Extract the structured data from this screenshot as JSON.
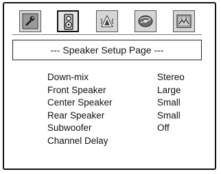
{
  "toolbar": {
    "tabs": [
      {
        "icon": "wrench-icon",
        "selected": false
      },
      {
        "icon": "speaker-icon",
        "selected": true
      },
      {
        "icon": "audio-icon",
        "selected": false
      },
      {
        "icon": "disc-icon",
        "selected": false
      },
      {
        "icon": "picture-icon",
        "selected": false
      }
    ]
  },
  "page": {
    "title": "--- Speaker Setup Page ---"
  },
  "menu": {
    "items": [
      {
        "label": "Down-mix",
        "value": "Stereo"
      },
      {
        "label": "Front Speaker",
        "value": "Large"
      },
      {
        "label": "Center Speaker",
        "value": "Small"
      },
      {
        "label": "Rear Speaker",
        "value": "Small"
      },
      {
        "label": "Subwoofer",
        "value": "Off"
      },
      {
        "label": "Channel Delay",
        "value": ""
      }
    ]
  }
}
